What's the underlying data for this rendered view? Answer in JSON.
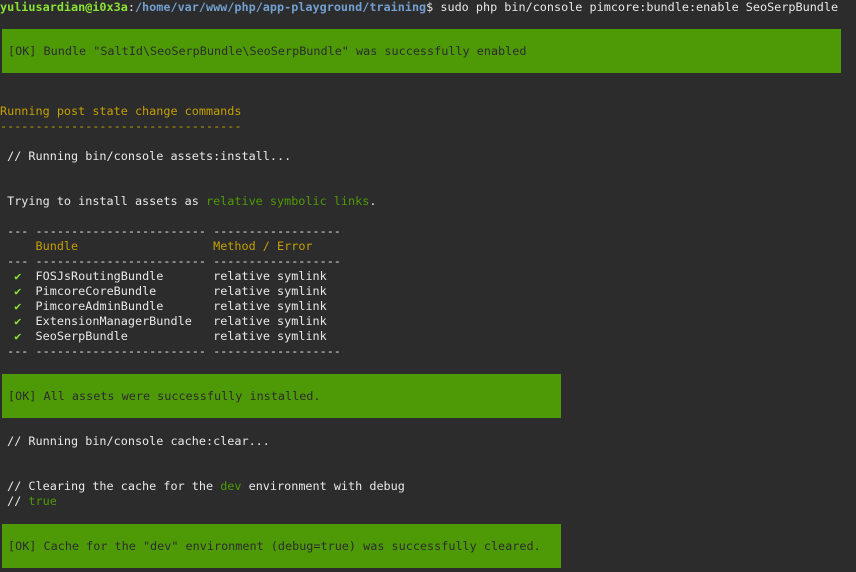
{
  "prompt": {
    "user_host": "yuliusardian@i0x3a",
    "sep": ":",
    "path": "/home/var/www/php/app-playground/training",
    "dollar": "$",
    "command": " sudo php bin/console pimcore:bundle:enable SeoSerpBundle"
  },
  "ok_enabled": "[OK] Bundle \"SaltId\\SeoSerpBundle\\SeoSerpBundle\" was successfully enabled",
  "post_state": {
    "title": "Running post state change commands",
    "underline": "----------------------------------"
  },
  "assets_install": {
    "running": " // Running bin/console assets:install...",
    "trying_prefix": " Trying to install assets as ",
    "trying_highlight": "relative symbolic links",
    "trying_suffix": ".",
    "sep_line": " --- ------------------------ ------------------",
    "header_bundle": "Bundle",
    "header_method": "Method / Error",
    "check": "✔",
    "rows": [
      {
        "bundle": "FOSJsRoutingBundle",
        "method": "relative symlink"
      },
      {
        "bundle": "PimcoreCoreBundle",
        "method": "relative symlink"
      },
      {
        "bundle": "PimcoreAdminBundle",
        "method": "relative symlink"
      },
      {
        "bundle": "ExtensionManagerBundle",
        "method": "relative symlink"
      },
      {
        "bundle": "SeoSerpBundle",
        "method": "relative symlink"
      }
    ]
  },
  "ok_assets": "[OK] All assets were successfully installed.",
  "cache_clear": {
    "running": " // Running bin/console cache:clear...",
    "clearing_prefix": " // Clearing the cache for the ",
    "env": "dev",
    "clearing_suffix": " environment with debug",
    "debug_prefix": " // ",
    "debug_value": "true"
  },
  "ok_cache": "[OK] Cache for the \"dev\" environment (debug=true) was successfully cleared."
}
